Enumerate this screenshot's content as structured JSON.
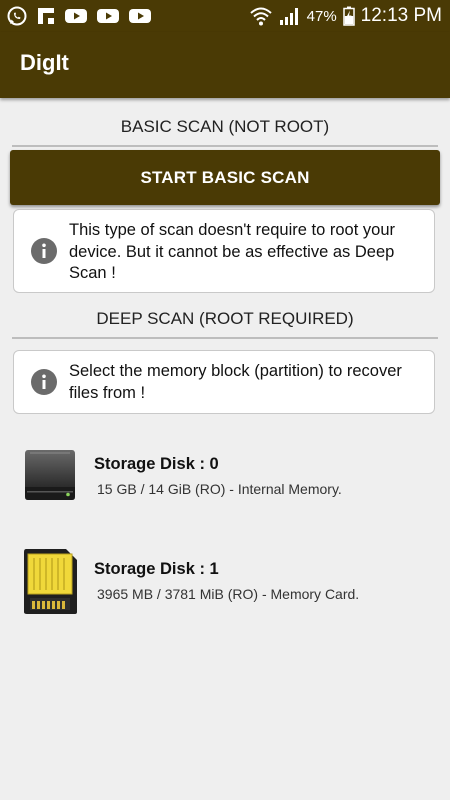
{
  "status_bar": {
    "icons": [
      "whatsapp-icon",
      "flipboard-icon",
      "youtube-icon",
      "youtube-icon",
      "youtube-icon",
      "wifi-icon",
      "signal-icon",
      "battery-icon"
    ],
    "battery": "47%",
    "time": "12:13 PM"
  },
  "app_bar": {
    "title": "DigIt"
  },
  "basic_scan": {
    "header": "BASIC SCAN (NOT ROOT)",
    "button_label": "START BASIC SCAN",
    "info": "This type of scan doesn't require to root your device. But it cannot be as effective as Deep Scan !"
  },
  "deep_scan": {
    "header": "DEEP SCAN (ROOT REQUIRED)",
    "info": "Select the memory block (partition) to recover files from !"
  },
  "disks": [
    {
      "title": "Storage Disk : 0",
      "detail": "15 GB / 14 GiB (RO) - Internal Memory.",
      "icon": "hard-disk-icon"
    },
    {
      "title": "Storage Disk : 1",
      "detail": "3965 MB / 3781 MiB (RO) - Memory Card.",
      "icon": "sd-card-icon"
    }
  ],
  "colors": {
    "primary": "#4a3a05",
    "background": "#efefef",
    "info_icon": "#6b6b6b"
  }
}
